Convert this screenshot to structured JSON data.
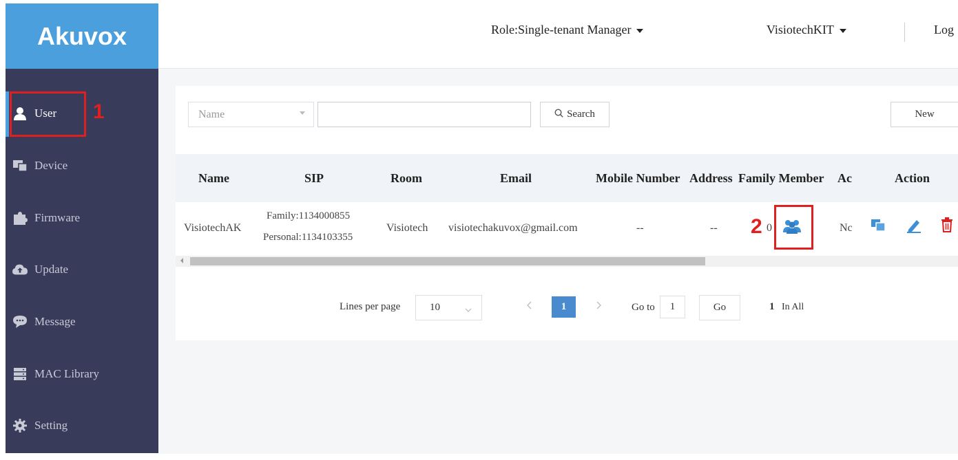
{
  "brand": {
    "logo": "Akuvox"
  },
  "sidebar": {
    "items": [
      {
        "label": "User",
        "icon": "user-icon"
      },
      {
        "label": "Device",
        "icon": "device-icon"
      },
      {
        "label": "Firmware",
        "icon": "puzzle-icon"
      },
      {
        "label": "Update",
        "icon": "cloud-upload-icon"
      },
      {
        "label": "Message",
        "icon": "chat-icon"
      },
      {
        "label": "MAC Library",
        "icon": "server-icon"
      },
      {
        "label": "Setting",
        "icon": "gear-icon"
      }
    ]
  },
  "annotations": {
    "step1": "1",
    "step2": "2"
  },
  "header": {
    "role": "Role:Single-tenant Manager",
    "account": "VisiotechKIT",
    "logout": "Log"
  },
  "search": {
    "field_select": "Name",
    "input_value": "",
    "search_label": "Search",
    "new_label": "New"
  },
  "table": {
    "columns": [
      "Name",
      "SIP",
      "Room",
      "Email",
      "Mobile Number",
      "Address",
      "Family Member",
      "Ac",
      "Action"
    ],
    "rows": [
      {
        "name": "VisiotechAK",
        "sip_family": "Family:1134000855",
        "sip_personal": "Personal:1134103355",
        "room": "Visiotech",
        "email": "visiotechakuvox@gmail.com",
        "mobile": "--",
        "address": "--",
        "family_member_count": "0",
        "ac": "Nc"
      }
    ]
  },
  "pagination": {
    "lines_per_page_label": "Lines per page",
    "lines_per_page": "10",
    "current_page": "1",
    "goto_label": "Go to",
    "goto_value": "1",
    "go_label": "Go",
    "total_count": "1",
    "total_label": "In All"
  },
  "colors": {
    "sidebar_bg": "#383b5a",
    "logo_bg": "#4a9fdc",
    "accent": "#4a8bd0",
    "annotation": "#e02020",
    "delete": "#e02020"
  }
}
